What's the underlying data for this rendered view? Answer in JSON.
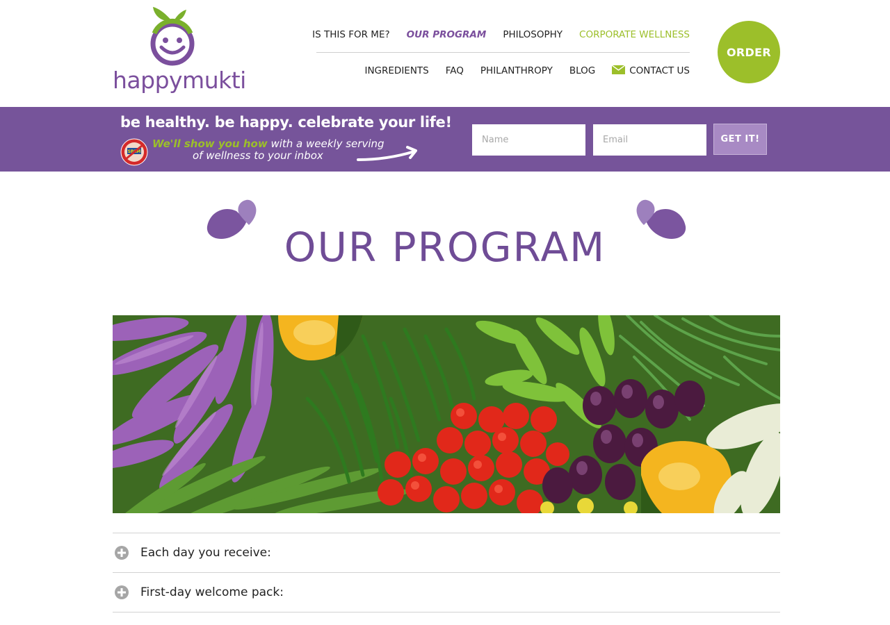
{
  "brand": {
    "name": "happymukti",
    "purple": "#76549a",
    "green": "#9cbf2a"
  },
  "nav": {
    "top": [
      {
        "label": "IS THIS FOR ME?",
        "state": "normal"
      },
      {
        "label": "OUR PROGRAM",
        "state": "active"
      },
      {
        "label": "PHILOSOPHY",
        "state": "normal"
      },
      {
        "label": "CORPORATE WELLNESS",
        "state": "highlight"
      }
    ],
    "bottom": [
      {
        "label": "INGREDIENTS"
      },
      {
        "label": "FAQ"
      },
      {
        "label": "PHILANTHROPY"
      },
      {
        "label": "BLOG"
      },
      {
        "label": "CONTACT US",
        "icon": "envelope-icon"
      }
    ],
    "order_label": "ORDER"
  },
  "banner": {
    "tagline": "be healthy. be happy. celebrate your life!",
    "highlight": "We'll show you how",
    "line1_rest": "with a weekly serving",
    "line2": "of wellness to your inbox",
    "spam_badge": "SPAM",
    "name_placeholder": "Name",
    "email_placeholder": "Email",
    "submit_label": "GET IT!"
  },
  "page": {
    "title": "OUR PROGRAM"
  },
  "accordion": [
    {
      "label": "Each day you receive:"
    },
    {
      "label": "First-day welcome pack:"
    }
  ]
}
